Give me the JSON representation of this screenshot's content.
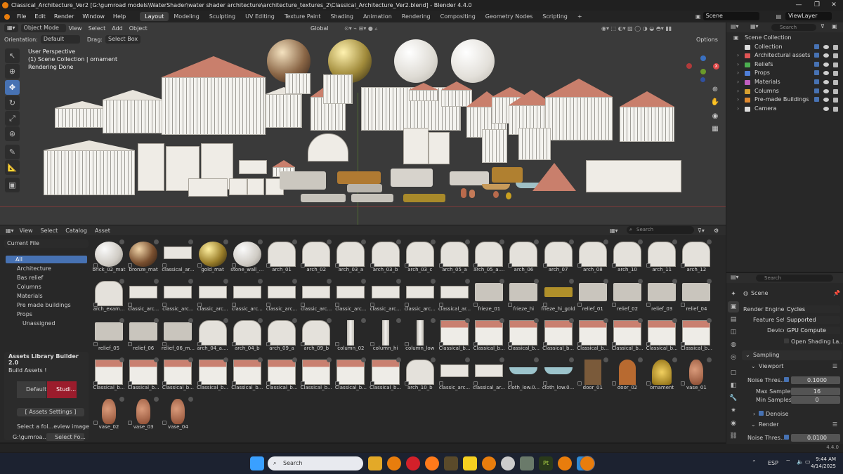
{
  "window": {
    "title": "Classical_Architecture_Ver2 [G:\\gumroad models\\WaterShader\\water shader architecture\\architecture_textures_2\\Classical_Architecture_Ver2.blend] - Blender 4.4.0",
    "controls": [
      "—",
      "❐",
      "✕"
    ]
  },
  "menubar": {
    "items": [
      "File",
      "Edit",
      "Render",
      "Window",
      "Help"
    ],
    "workspaces": [
      "Layout",
      "Modeling",
      "Sculpting",
      "UV Editing",
      "Texture Paint",
      "Shading",
      "Animation",
      "Rendering",
      "Compositing",
      "Geometry Nodes",
      "Scripting"
    ],
    "active_workspace": "Layout",
    "add_tab": "+",
    "scene": "Scene",
    "view_layer": "ViewLayer"
  },
  "viewport": {
    "mode": "Object Mode",
    "menus": [
      "View",
      "Select",
      "Add",
      "Object"
    ],
    "transform_orientation": "Global",
    "orientation_label": "Orientation:",
    "orientation_value": "Default",
    "drag_label": "Drag:",
    "drag_value": "Select Box",
    "options": "Options",
    "overlay_lines": [
      "User Perspective",
      "(1) Scene Collection | ornament",
      "Rendering Done"
    ],
    "gizmo_axes": [
      "X",
      "Y",
      "Z"
    ]
  },
  "asset_browser": {
    "menus": [
      "View",
      "Select",
      "Catalog",
      "Asset"
    ],
    "library": "Current File",
    "search_placeholder": "Search",
    "catalogs": {
      "all": "All",
      "children": [
        "Architecture",
        "Bas relief",
        "Columns",
        "Materials",
        "Pre made buildings",
        "Props"
      ],
      "unassigned": "Unassigned"
    },
    "addon": {
      "title": "Assets Library Builder 2.0",
      "build": "Build Assets !",
      "default": "Default",
      "studio": "Studi...",
      "settings": "[ Assets Settings ]",
      "select_folder_hint": "Select a fol...eview image",
      "path": "G:\\gumroa...",
      "select_folder": "Select Fo..."
    },
    "assets": [
      "brick_02_mat",
      "bronze_mat",
      "classical_ar...",
      "gold_mat",
      "stone_wall_...",
      "arch_01",
      "arch_02",
      "arch_03_a",
      "arch_03_b",
      "arch_03_c",
      "arch_05_a",
      "arch_05_a....",
      "arch_06",
      "arch_07",
      "arch_08",
      "arch_10",
      "arch_11",
      "arch_12",
      "arch_exam...",
      "classic_arc...",
      "classic_arc...",
      "classic_arc...",
      "classic_arc...",
      "classic_arc...",
      "classic_arc...",
      "classic_arc...",
      "classic_arc...",
      "classic_arc...",
      "classical_ar...",
      "frieze_01",
      "frieze_hi",
      "frieze_hi_gold",
      "relief_01",
      "relief_02",
      "relief_03",
      "relief_04",
      "relief_05",
      "relief_06",
      "relief_06_m...",
      "arch_04_a....",
      "arch_04_b",
      "arch_09_a",
      "arch_09_b",
      "column_02",
      "column_hi",
      "column_low",
      "Classical_b...",
      "Classical_b...",
      "Classical_b...",
      "Classical_b...",
      "Classical_b...",
      "Classical_b...",
      "Classical_b...",
      "Classical_b...",
      "Classical_b...",
      "Classical_b...",
      "Classical_b...",
      "Classical_b...",
      "Classical_b...",
      "Classical_b...",
      "Classical_b...",
      "Classical_b...",
      "Classical_b...",
      "arch_10_b",
      "classic_arc...",
      "classical_ar...",
      "cloth_low.0...",
      "cloth_low.0...",
      "door_01",
      "door_02",
      "ornament",
      "vase_01",
      "vase_02",
      "vase_03",
      "vase_04"
    ]
  },
  "outliner": {
    "search_placeholder": "Search",
    "root": "Scene Collection",
    "rows": [
      {
        "name": "Collection",
        "color": "#dddddd"
      },
      {
        "name": "Architectural assets",
        "color": "#e05555"
      },
      {
        "name": "Reliefs",
        "color": "#4caf50"
      },
      {
        "name": "Props",
        "color": "#4f7fd8"
      },
      {
        "name": "Materials",
        "color": "#c05fc0"
      },
      {
        "name": "Columns",
        "color": "#d7a030"
      },
      {
        "name": "Pre-made Buildings",
        "color": "#e08a30"
      },
      {
        "name": "Camera",
        "color": "#dddddd"
      }
    ]
  },
  "properties": {
    "search_placeholder": "Search",
    "context": "Scene",
    "render_engine_label": "Render Engine",
    "render_engine": "Cycles",
    "feature_set_label": "Feature Set",
    "feature_set": "Supported",
    "device_label": "Device",
    "device": "GPU Compute",
    "open_shading": "Open Shading La...",
    "sampling": "Sampling",
    "viewport": "Viewport",
    "noise_label": "Noise Thres...",
    "noise_viewport": "0.1000",
    "max_samples_label": "Max Samples",
    "max_samples": "16",
    "min_samples_label": "Min Samples",
    "min_samples": "0",
    "denoise": "Denoise",
    "render": "Render",
    "noise_render": "0.0100"
  },
  "status": {
    "version": "4.4.0"
  },
  "taskbar": {
    "search_placeholder": "Search",
    "lang": "ESP",
    "time": "9:44 AM",
    "date": "4/14/2025"
  }
}
